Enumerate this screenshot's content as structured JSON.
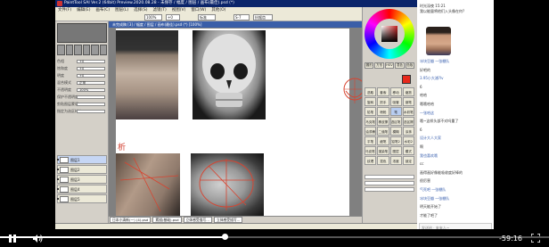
{
  "sai": {
    "title": "PaintTool SAI Ver.2 (64bit) Preview.2020.08.28 - 未保存 / 幅度 / 图层 / 画布(最佳).psd (*)",
    "menu": [
      "文件(F)",
      "编辑(E)",
      "画布(C)",
      "图层(L)",
      "选择(S)",
      "滤镜(T)",
      "视图(V)",
      "窗口(W)",
      "其他(O)"
    ],
    "toolbar": {
      "zoom": "100%",
      "angle": "+0",
      "mode": "标准",
      "stabilizer": "S-7",
      "antialias": "抗锯齿"
    },
    "canvas_tab": "未完成稿 [3] / 幅度 / 图层 / 画布(最佳).psd (*) [100%]",
    "canvas_note": "析",
    "left_panel": {
      "rows": [
        {
          "label": "色相",
          "value": "+0"
        },
        {
          "label": "饱和度",
          "value": "+0"
        },
        {
          "label": "明度",
          "value": "+0"
        },
        {
          "label": "混合模式",
          "value": "正常"
        },
        {
          "label": "不透明度",
          "value": "100%"
        },
        {
          "label": "保护不透明度",
          "value": ""
        },
        {
          "label": "剪贴图层蒙版",
          "value": ""
        },
        {
          "label": "指定为选区样本",
          "value": ""
        }
      ],
      "layers": [
        {
          "name": "图层1",
          "selected": true
        },
        {
          "name": "图层2",
          "selected": false
        },
        {
          "name": "图层3",
          "selected": false
        },
        {
          "name": "图层4",
          "selected": false
        },
        {
          "name": "图层5",
          "selected": false
        }
      ]
    },
    "bottom_tabs": [
      "日本小清新(一) (4).psd",
      "素描(基础).psd",
      "立体感受描写...",
      "立体感受描写..."
    ],
    "right_panel": {
      "modes": [
        "圆形",
        "方形",
        "HSV",
        "混色",
        "色板"
      ],
      "current_color": "#e8291c",
      "tools": [
        "选取",
        "套索",
        "移动",
        "缩放",
        "旋转",
        "抓手",
        "吸管",
        "钢笔",
        "铅笔",
        "喷枪",
        "笔",
        "水彩笔",
        "马克笔",
        "橡皮擦",
        "选区笔",
        "选区擦",
        "油漆桶",
        "二值笔",
        "模糊",
        "涂抹",
        "平笔",
        "细笔",
        "铅笔2",
        "水彩2",
        "马克笔2",
        "渲染笔",
        "图层",
        "模式",
        "纹理",
        "混色",
        "浓度",
        "锁定"
      ],
      "active_tool_index": 10
    }
  },
  "chat": {
    "header_lines": [
      "时光深夜 15:21",
      "我以能量将他们入头像在何?"
    ],
    "messages": [
      {
        "text": "冰块豆瓣 一张棚队",
        "blue": true
      },
      {
        "text": "好吧的",
        "blue": false
      },
      {
        "text": "3.95小大浦?lv",
        "blue": true
      },
      {
        "text": "6",
        "blue": false
      },
      {
        "text": "哈哈",
        "blue": false
      },
      {
        "text": "哦哦哈哈",
        "blue": false
      },
      {
        "text": "一张哈这",
        "blue": true
      },
      {
        "text": "哦~这样头部不对吗重了",
        "blue": false
      },
      {
        "text": "6",
        "blue": false
      },
      {
        "text": "设计大人大家",
        "blue": true
      },
      {
        "text": "啊",
        "blue": false
      },
      {
        "text": "我也喜欢哦",
        "blue": true
      },
      {
        "text": "cc",
        "blue": false
      },
      {
        "text": "画得画好像能吸收度好棒的",
        "blue": false
      },
      {
        "text": "很厉害",
        "blue": false
      },
      {
        "text": "气死吧 一张棚队",
        "blue": true
      },
      {
        "text": "冰块豆瓣 一张棚队",
        "blue": true
      },
      {
        "text": "明天能开始了",
        "blue": false
      },
      {
        "text": "才能了吧了",
        "blue": false
      }
    ],
    "input_placeholder": "发送给 · 来来人~"
  },
  "player": {
    "time_remaining": "-59:16",
    "progress": 0.41,
    "accent": "#ffffff"
  }
}
